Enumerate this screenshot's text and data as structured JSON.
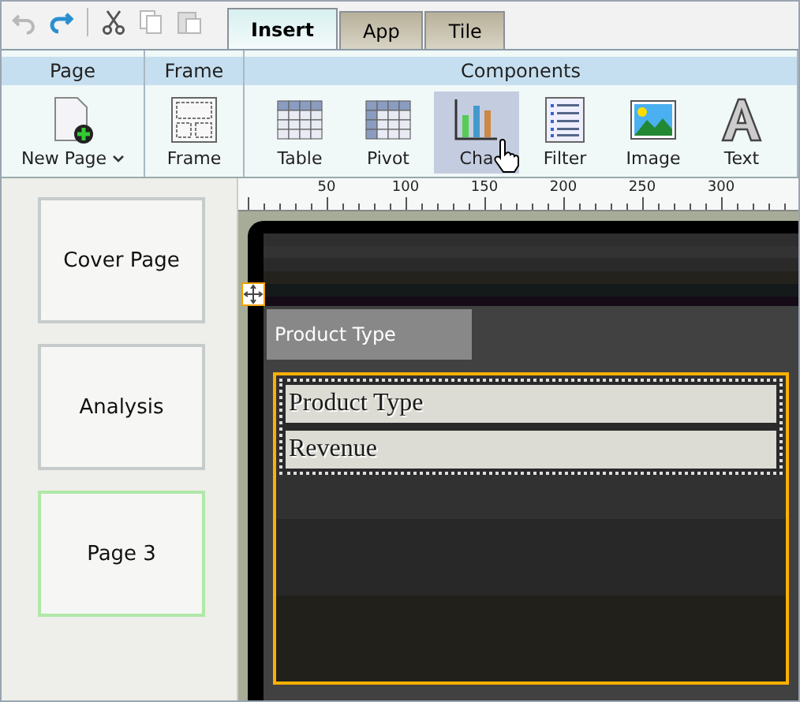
{
  "quick_toolbar": [
    {
      "kind": "undo",
      "disabled": true
    },
    {
      "kind": "redo",
      "disabled": false
    },
    {
      "kind": "cut",
      "disabled": false
    },
    {
      "kind": "copy",
      "disabled": true
    },
    {
      "kind": "paste",
      "disabled": true
    }
  ],
  "tabs": [
    {
      "label": "Insert",
      "selected": true
    },
    {
      "label": "App",
      "selected": false
    },
    {
      "label": "Tile",
      "selected": false
    }
  ],
  "ribbon": [
    {
      "title": "Page",
      "items": [
        {
          "label": "New Page",
          "kind": "newpage",
          "dropdown": true,
          "selected": false
        }
      ]
    },
    {
      "title": "Frame",
      "items": [
        {
          "label": "Frame",
          "kind": "frame",
          "dropdown": false,
          "selected": false
        }
      ]
    },
    {
      "title": "Components",
      "items": [
        {
          "label": "Table",
          "kind": "table",
          "dropdown": false,
          "selected": false
        },
        {
          "label": "Pivot",
          "kind": "pivot",
          "dropdown": false,
          "selected": false
        },
        {
          "label": "Cha",
          "kind": "chart",
          "dropdown": false,
          "selected": true
        },
        {
          "label": "Filter",
          "kind": "filter",
          "dropdown": false,
          "selected": false
        },
        {
          "label": "Image",
          "kind": "image",
          "dropdown": false,
          "selected": false
        },
        {
          "label": "Text",
          "kind": "text",
          "dropdown": false,
          "selected": false
        }
      ]
    }
  ],
  "pages": [
    {
      "label": "Cover Page",
      "selected": false
    },
    {
      "label": "Analysis",
      "selected": false
    },
    {
      "label": "Page 3",
      "selected": true
    }
  ],
  "ruler": {
    "labels": [
      "50",
      "100",
      "150",
      "200",
      "250",
      "300"
    ]
  },
  "canvas": {
    "header_label": "Product Type",
    "fields": [
      "Product Type",
      "Revenue"
    ]
  }
}
